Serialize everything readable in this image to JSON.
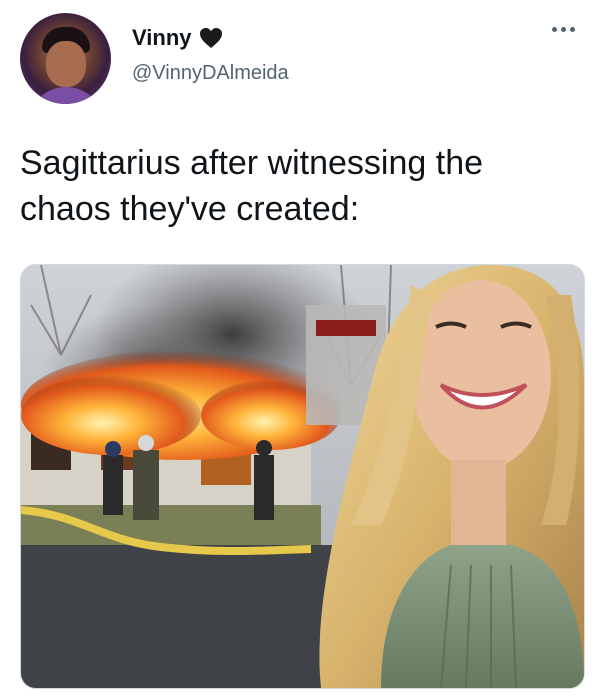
{
  "user": {
    "display_name": "Vinny",
    "badge_icon": "black-heart-icon",
    "handle": "@VinnyDAlmeida"
  },
  "tweet": {
    "text": "Sagittarius after witnessing the chaos they've created:"
  },
  "menu": {
    "icon": "more-options-icon"
  },
  "colors": {
    "text": "#0f1419",
    "secondary_text": "#536471",
    "border": "#cfd9de"
  }
}
